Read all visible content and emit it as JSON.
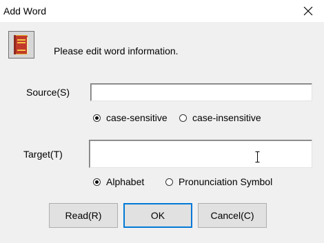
{
  "window": {
    "title": "Add Word"
  },
  "info": {
    "message": "Please edit word information."
  },
  "source": {
    "label": "Source(S)",
    "value": "",
    "options": [
      {
        "label": "case-sensitive",
        "checked": true
      },
      {
        "label": "case-insensitive",
        "checked": false
      }
    ]
  },
  "target": {
    "label": "Target(T)",
    "value": "",
    "options": [
      {
        "label": "Alphabet",
        "checked": true
      },
      {
        "label": "Pronunciation Symbol",
        "checked": false
      }
    ]
  },
  "buttons": {
    "read": "Read(R)",
    "ok": "OK",
    "cancel": "Cancel(C)"
  },
  "icons": {
    "app": "dictionary-book-icon",
    "close": "close-icon"
  },
  "colors": {
    "accent": "#0078d7",
    "book_red": "#c0392b",
    "book_gold": "#e6a817"
  }
}
